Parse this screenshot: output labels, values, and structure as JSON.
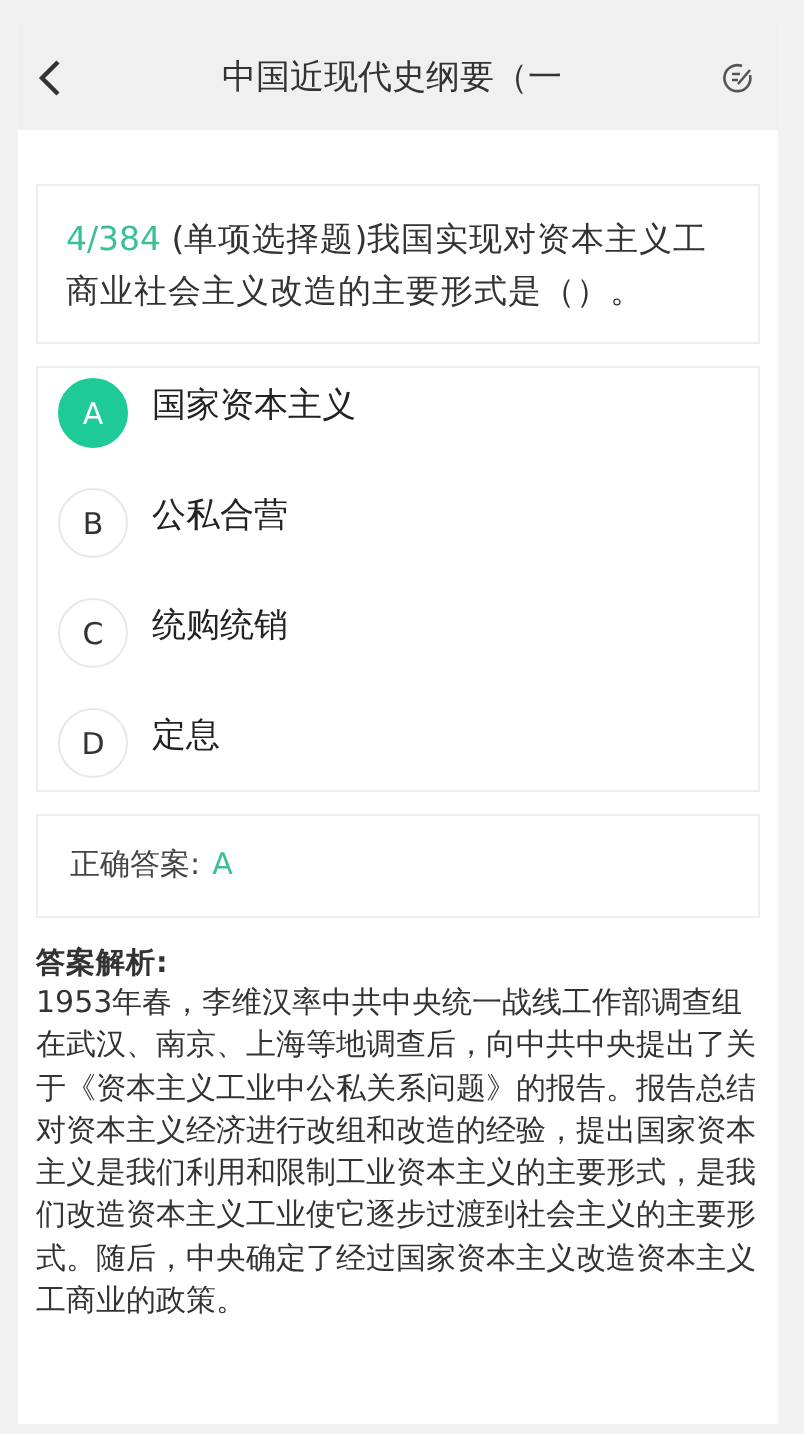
{
  "header": {
    "title": "中国近现代史纲要（一"
  },
  "question": {
    "number": "4/384",
    "text": "(单项选择题)我国实现对资本主义工商业社会主义改造的主要形式是（）。"
  },
  "options": [
    {
      "letter": "A",
      "text": "国家资本主义",
      "selected": true
    },
    {
      "letter": "B",
      "text": "公私合营",
      "selected": false
    },
    {
      "letter": "C",
      "text": "统购统销",
      "selected": false
    },
    {
      "letter": "D",
      "text": "定息",
      "selected": false
    }
  ],
  "answer": {
    "label": "正确答案:",
    "value": "A"
  },
  "explanation": {
    "title": "答案解析:",
    "text": "1953年春，李维汉率中共中央统一战线工作部调查组在武汉、南京、上海等地调查后，向中共中央提出了关于《资本主义工业中公私关系问题》的报告。报告总结对资本主义经济进行改组和改造的经验，提出国家资本主义是我们利用和限制工业资本主义的主要形式，是我们改造资本主义工业使它逐步过渡到社会主义的主要形式。随后，中央确定了经过国家资本主义改造资本主义工商业的政策。"
  }
}
